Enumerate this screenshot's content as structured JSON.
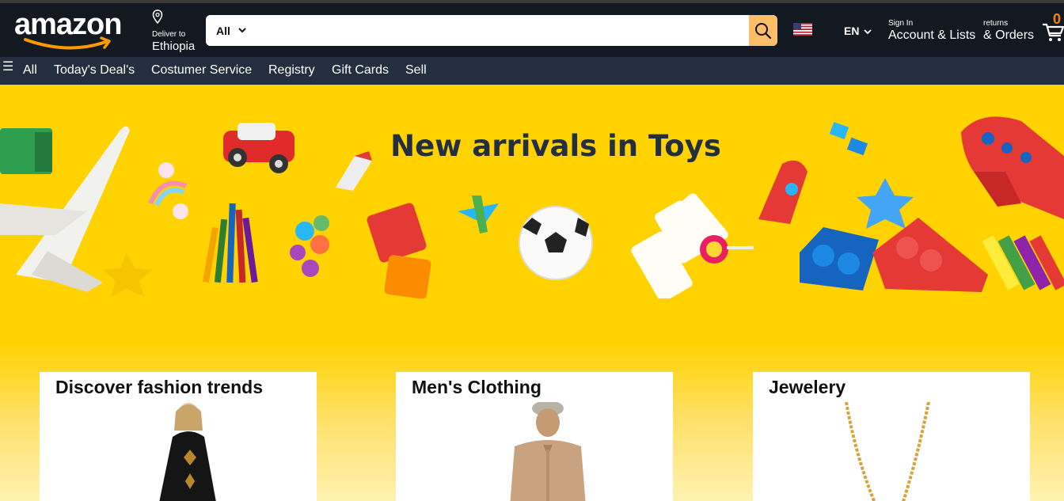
{
  "header": {
    "logo_text": "amazon",
    "deliver_small": "Deliver to",
    "deliver_location": "Ethiopia",
    "search_category": "All",
    "search_placeholder": "",
    "lang": "EN",
    "account_small": "Sign In",
    "account_big": "Account & Lists",
    "orders_small": "returns",
    "orders_big": "& Orders",
    "cart_count": "0"
  },
  "nav": {
    "items": [
      "All",
      "Today's Deal's",
      "Costumer Service",
      "Registry",
      "Gift Cards",
      "Sell"
    ]
  },
  "hero": {
    "title": "New arrivals in Toys"
  },
  "cards": [
    {
      "title": "Discover fashion trends"
    },
    {
      "title": "Men's Clothing"
    },
    {
      "title": "Jewelery"
    }
  ],
  "colors": {
    "header_bg": "#131921",
    "nav_bg": "#232f3e",
    "search_button": "#febd69",
    "hero_bg": "#ffd200",
    "cart_count": "#f08804"
  },
  "icons": [
    "amazon-smile-logo",
    "location-pin-icon",
    "chevron-down-icon",
    "search-icon",
    "us-flag-icon",
    "cart-icon",
    "hamburger-menu-icon"
  ]
}
